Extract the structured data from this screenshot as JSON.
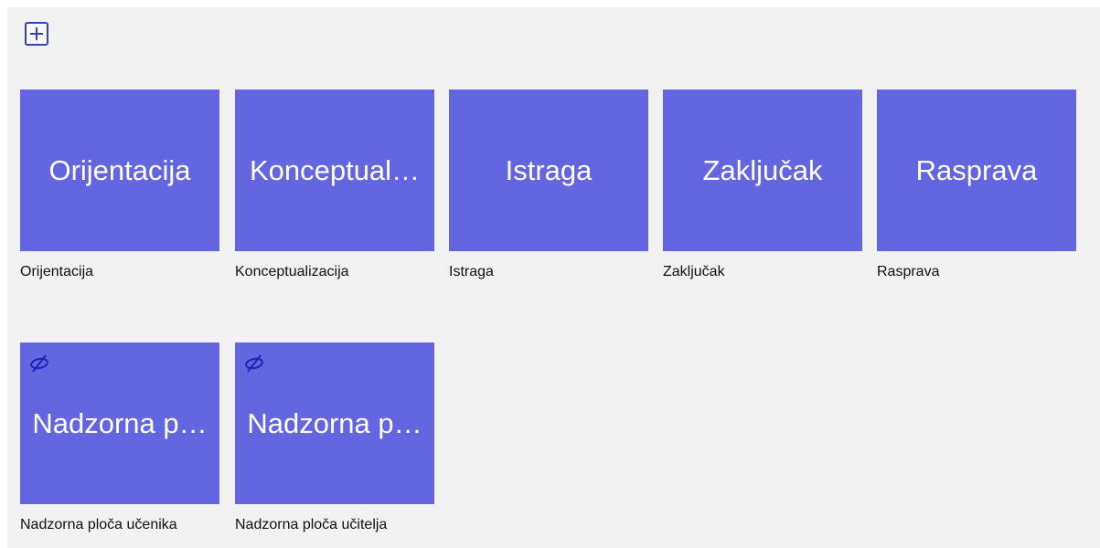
{
  "toolbar": {
    "add_icon": "plus-icon"
  },
  "colors": {
    "tile_background": "#6366e0",
    "tile_text": "#ffffff",
    "hidden_icon": "#1f23b8",
    "page_background": "#f2f2f2"
  },
  "tiles": [
    {
      "title": "Orijentacija",
      "label": "Orijentacija",
      "hidden": false
    },
    {
      "title": "Konceptual…",
      "label": "Konceptualizacija",
      "hidden": false
    },
    {
      "title": "Istraga",
      "label": "Istraga",
      "hidden": false
    },
    {
      "title": "Zaključak",
      "label": "Zaključak",
      "hidden": false
    },
    {
      "title": "Rasprava",
      "label": "Rasprava",
      "hidden": false
    },
    {
      "title": "Nadzorna p…",
      "label": "Nadzorna ploča učenika",
      "hidden": true,
      "hidden_icon": "eye-off-icon"
    },
    {
      "title": "Nadzorna p…",
      "label": "Nadzorna ploča učitelja",
      "hidden": true,
      "hidden_icon": "eye-off-icon"
    }
  ]
}
